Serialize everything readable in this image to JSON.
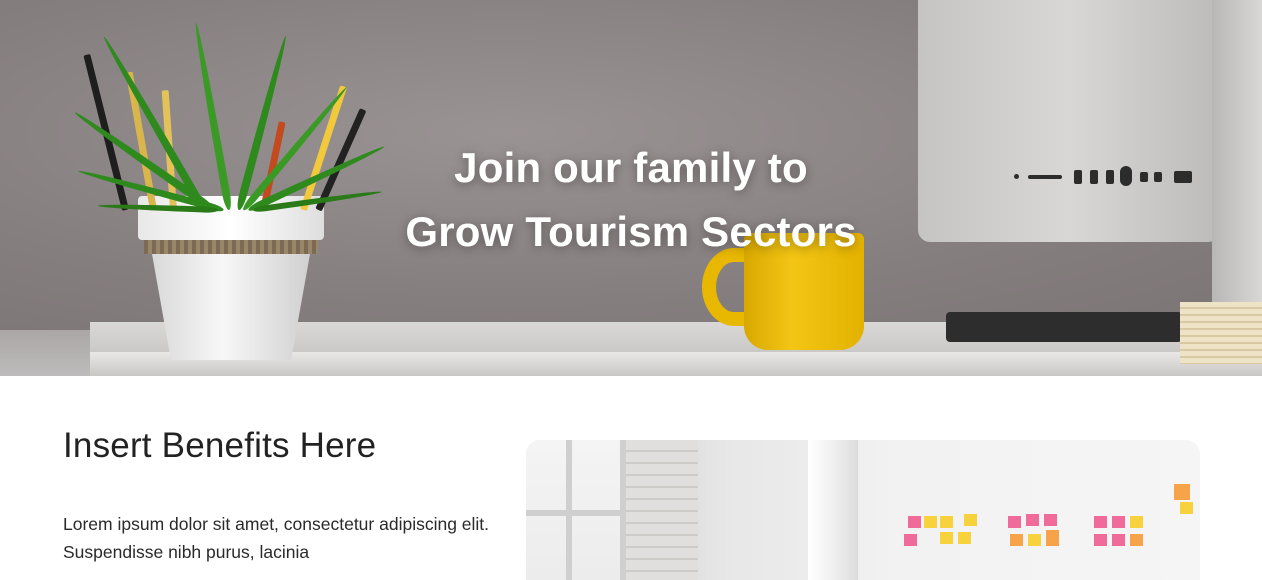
{
  "hero": {
    "title_line1": "Join our family to",
    "title_line2": "Grow Tourism Sectors"
  },
  "benefits": {
    "heading": "Insert Benefits Here",
    "body": "Lorem ipsum dolor sit amet, consectetur adipiscing elit. Suspendisse nibh purus, lacinia"
  },
  "images": {
    "hero_background": "office-desk-photo",
    "benefits_photo": "office-sticky-notes-photo"
  },
  "colors": {
    "hero_text": "#ffffff",
    "heading_text": "#222222",
    "body_text": "#2a2a2a",
    "mug_yellow": "#f3c515"
  }
}
